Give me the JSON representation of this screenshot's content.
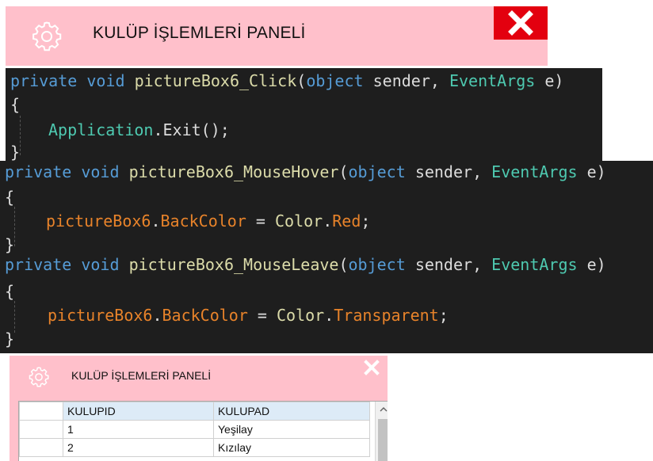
{
  "top_panel": {
    "title": "KULÜP İŞLEMLERİ PANELİ",
    "icons": {
      "settings": "gear-icon",
      "close": "close-icon"
    },
    "colors": {
      "background": "#ffc0cb",
      "close_bg": "#e3000f"
    }
  },
  "code_blocks": [
    {
      "signature": {
        "kw1": "private",
        "kw2": "void",
        "method": "pictureBox6_Click",
        "p_open": "(",
        "type1": "object",
        "arg1": "sender",
        "comma": ",",
        "type2": "EventArgs",
        "arg2": "e",
        "p_close": ")"
      },
      "open_brace": "{",
      "body": {
        "obj": "Application",
        "rest": ".Exit();"
      },
      "close_brace": "}"
    },
    {
      "signature": {
        "kw1": "private",
        "kw2": "void",
        "method": "pictureBox6_MouseHover",
        "p_open": "(",
        "type1": "object",
        "arg1": "sender",
        "comma": ",",
        "type2": "EventArgs",
        "arg2": "e",
        "p_close": ")"
      },
      "open_brace": "{",
      "body": {
        "obj": "pictureBox6",
        "dot1": ".",
        "prop": "BackColor",
        "eq": " = ",
        "cls": "Color",
        "dot2": ".",
        "val": "Red",
        "end": ";"
      },
      "close_brace": "}"
    },
    {
      "signature": {
        "kw1": "private",
        "kw2": "void",
        "method": "pictureBox6_MouseLeave",
        "p_open": "(",
        "type1": "object",
        "arg1": "sender",
        "comma": ",",
        "type2": "EventArgs",
        "arg2": "e",
        "p_close": ")"
      },
      "open_brace": "{",
      "body": {
        "obj": "pictureBox6",
        "dot1": ".",
        "prop": "BackColor",
        "eq": " = ",
        "cls": "Color",
        "dot2": ".",
        "val": "Transparent",
        "end": ";"
      },
      "close_brace": "}"
    }
  ],
  "bottom_panel": {
    "title": "KULÜP İŞLEMLERİ PANELİ",
    "icons": {
      "settings": "gear-icon",
      "close": "close-icon",
      "scroll_up": "scroll-up-arrow-icon"
    },
    "grid": {
      "columns": [
        "KULUPID",
        "KULUPAD"
      ],
      "rows": [
        {
          "id": "1",
          "name": "Yeşilay"
        },
        {
          "id": "2",
          "name": "Kızılay"
        }
      ]
    }
  }
}
